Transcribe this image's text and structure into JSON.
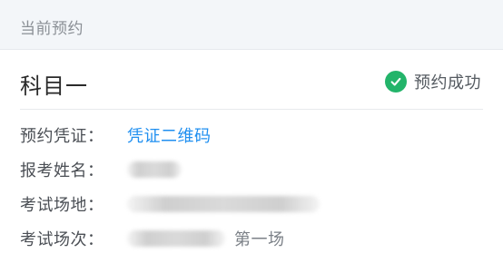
{
  "header": {
    "title": "当前预约"
  },
  "card": {
    "subject": "科目一",
    "status": {
      "text": "预约成功",
      "icon": "check-circle-icon",
      "color": "#23b46a"
    },
    "fields": [
      {
        "label": "预约凭证：",
        "value": "凭证二维码"
      },
      {
        "label": "报考姓名："
      },
      {
        "label": "考试场地："
      },
      {
        "label": "考试场次：",
        "suffix": "第一场"
      }
    ]
  },
  "colors": {
    "link": "#1f8ff0",
    "header_bg": "#f3f6f9"
  }
}
